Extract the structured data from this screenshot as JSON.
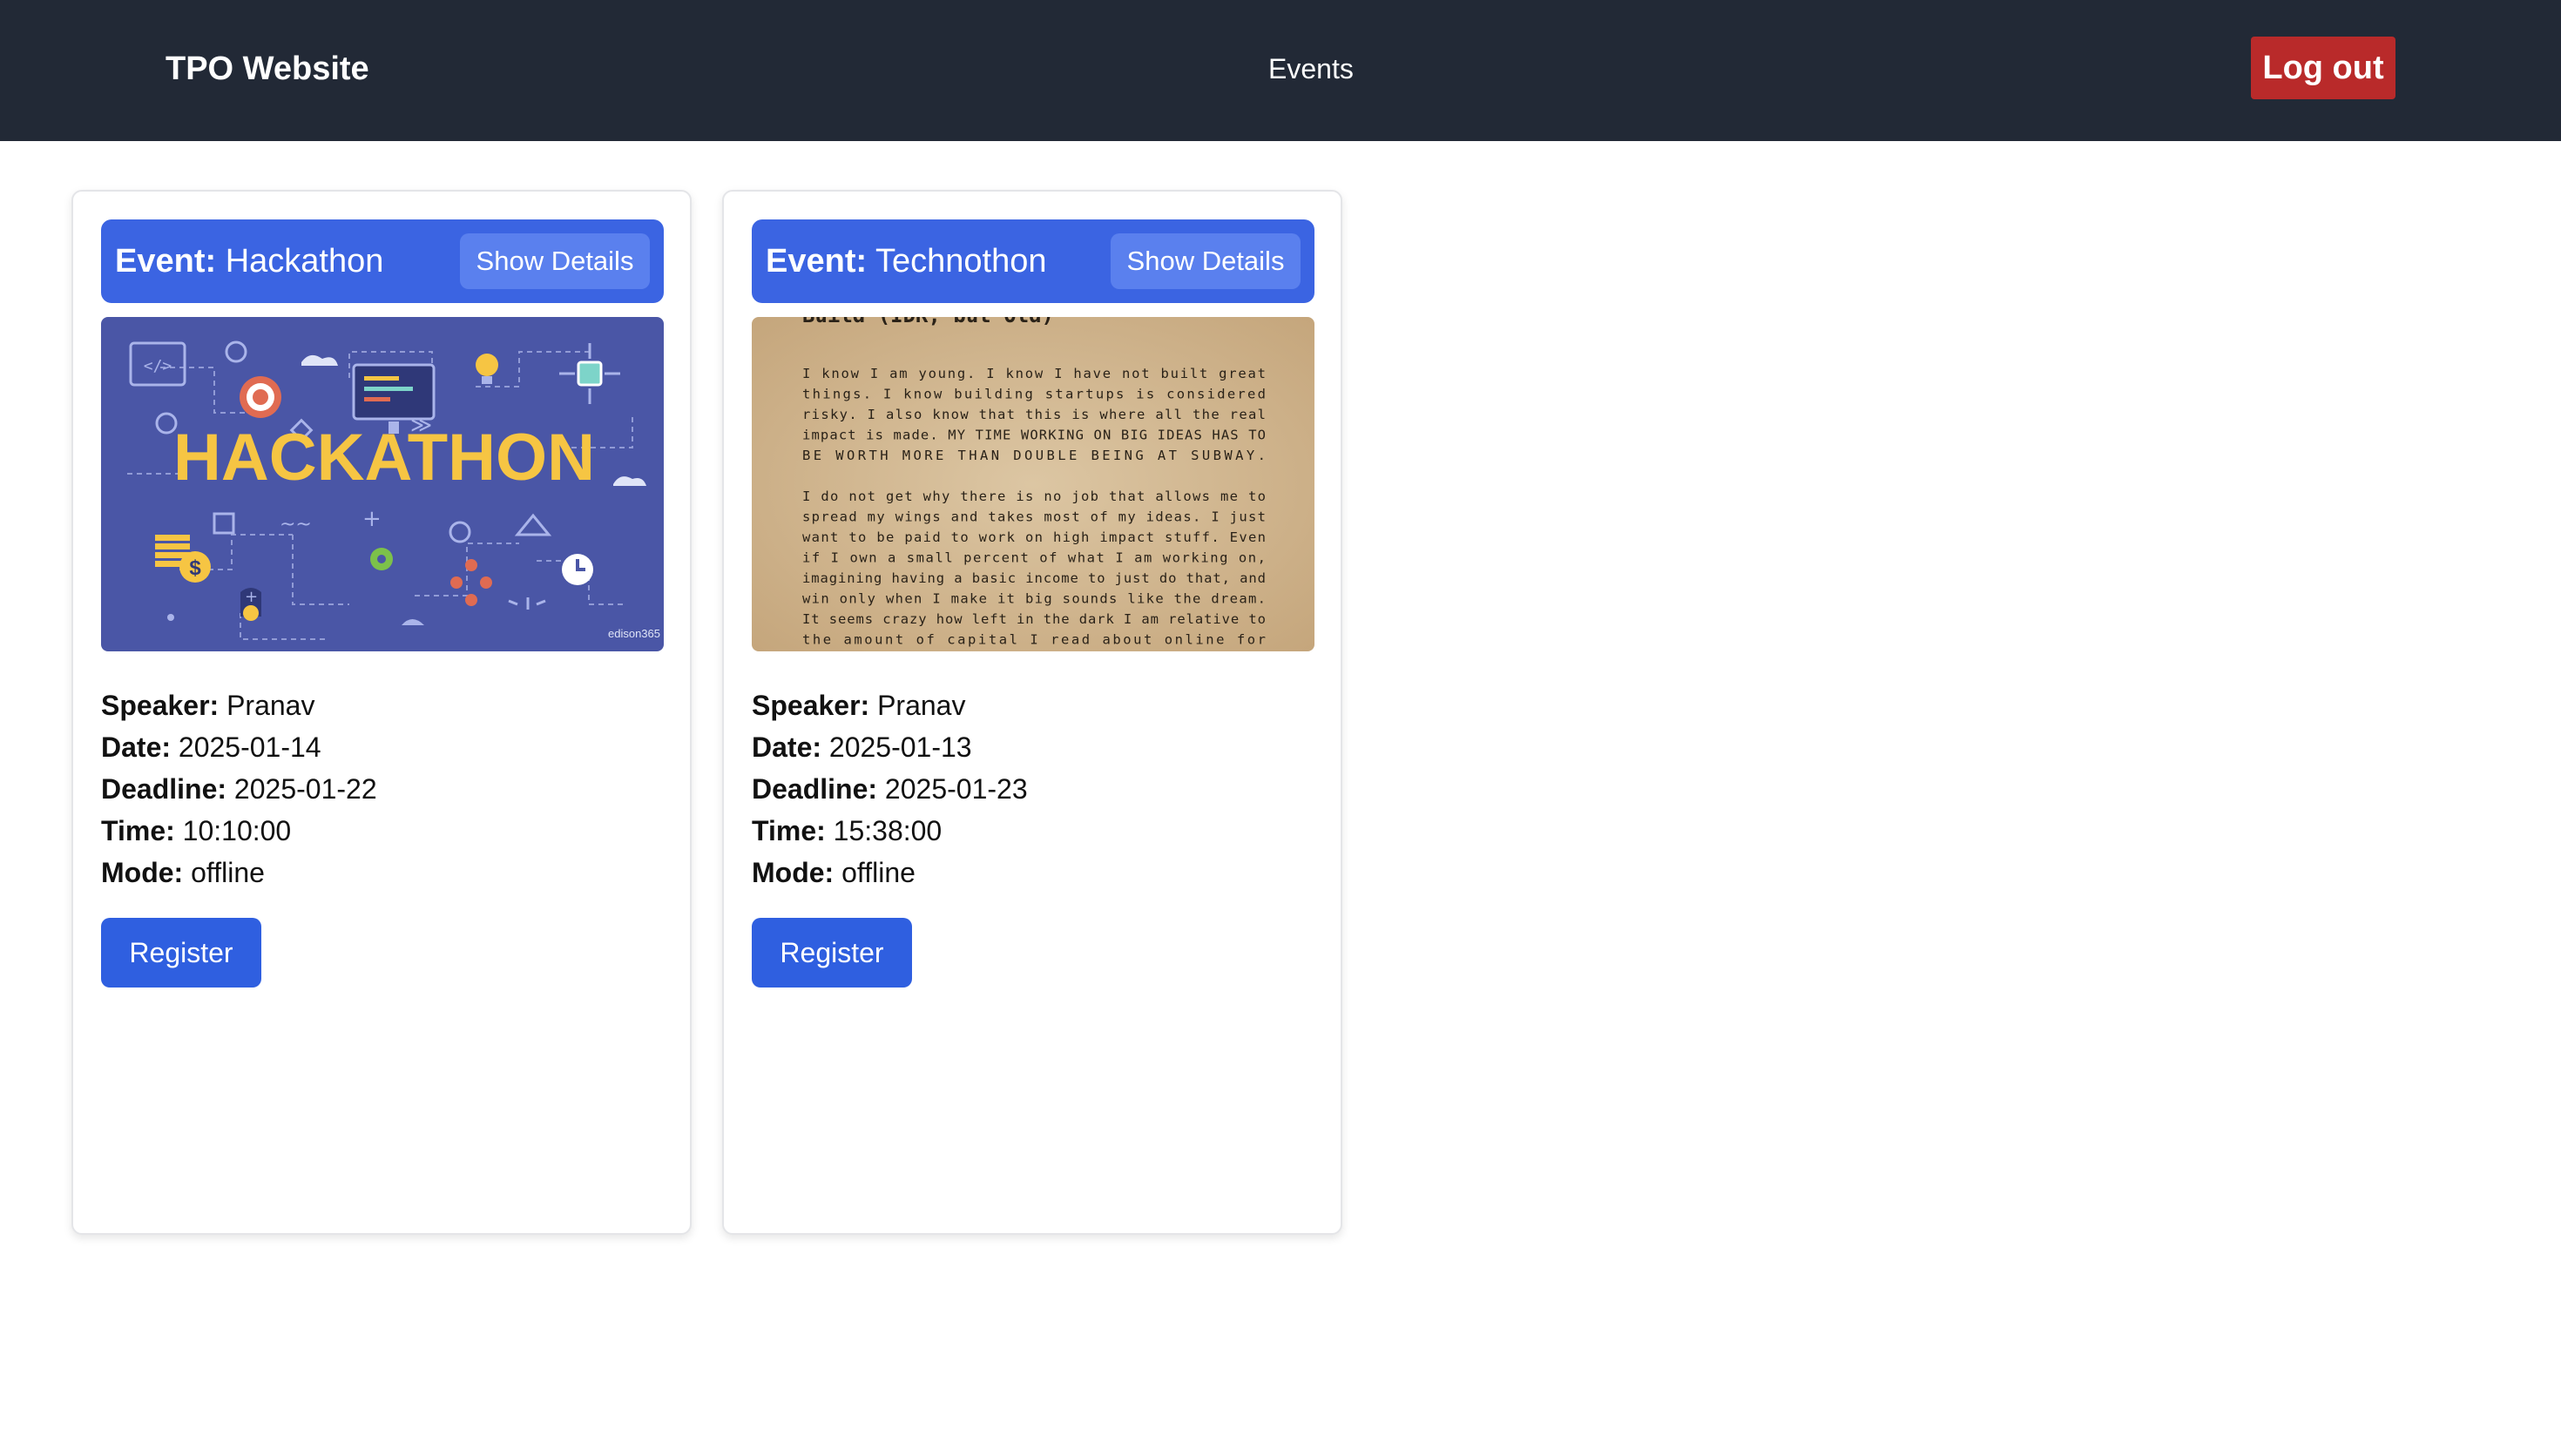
{
  "navbar": {
    "brand": "TPO Website",
    "links": [
      "Events"
    ],
    "logout_label": "Log out"
  },
  "labels": {
    "event": "Event:",
    "speaker": "Speaker:",
    "date": "Date:",
    "deadline": "Deadline:",
    "time": "Time:",
    "mode": "Mode:",
    "show_details": "Show Details",
    "register": "Register"
  },
  "events": [
    {
      "name": "Hackathon",
      "speaker": "Pranav",
      "date": "2025-01-14",
      "deadline": "2025-01-22",
      "time": "10:10:00",
      "mode": "offline",
      "image": {
        "title_text": "HACKATHON",
        "watermark": "edison365"
      }
    },
    {
      "name": "Technothon",
      "speaker": "Pranav",
      "date": "2025-01-13",
      "deadline": "2025-01-23",
      "time": "15:38:00",
      "mode": "offline",
      "image": {
        "lines": [
          "Build (IDK, but Old)",
          "I know I am young. I know I have not built great",
          "things.  I  know  building  startups  is  considered",
          "risky. I also know that this is where all the real",
          "impact is made. MY TIME WORKING ON BIG IDEAS HAS TO",
          "BE WORTH MORE THAN DOUBLE BEING AT SUBWAY.",
          "",
          "I do not get why there is no job that allows me to",
          "spread my wings and takes most of my ideas. I just",
          "want to be paid to work on high impact stuff. Even",
          "if I own a small percent of what I am working on,",
          "imagining having a basic income to just do that, and",
          "win only when I make it big sounds like the dream.",
          "It seems crazy how left in the dark I am relative to",
          "the  amount  of  capital  I  read  about  online  for"
        ]
      }
    }
  ],
  "colors": {
    "navbar_bg": "#222936",
    "logout_bg": "#b92a2a",
    "header_bg": "#3b64e2",
    "details_btn_bg": "#5a80ee",
    "register_bg": "#2f5fe0",
    "hackathon_bg": "#4a56a6",
    "hackathon_title": "#f6c543",
    "paper_bg": "#d8c2a0"
  }
}
